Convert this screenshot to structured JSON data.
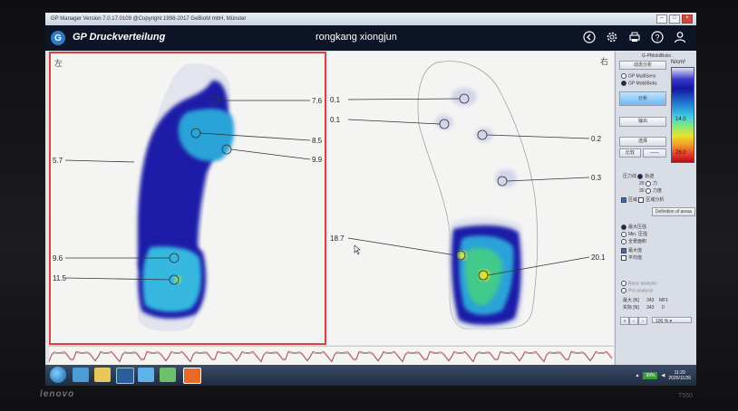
{
  "window": {
    "title": "GP Manager    Version 7.0.17.0109     @Copyright 1998-2017 GeBioM mbH, Münster"
  },
  "header": {
    "app_title": "GP Druckverteilung",
    "patient_name": "rongkang xiongjun"
  },
  "header_icons": [
    "back-icon",
    "gear-icon",
    "print-icon",
    "help-icon",
    "user-icon"
  ],
  "left_foot": {
    "side_label": "左",
    "values": [
      "7.6",
      "8.5",
      "9.9",
      "5.7",
      "9.6",
      "11.5"
    ]
  },
  "right_foot": {
    "side_label": "右",
    "values": [
      "0.1",
      "0.1",
      "0.2",
      "0.3",
      "18.7",
      "20.1"
    ]
  },
  "sidebar": {
    "title": "G-PMobilBoks",
    "top_button": "动态分析",
    "radio1": "GP MultiSens",
    "radio2": "GP MobilBoks",
    "btn_analysis": "分析",
    "btn2": "输出",
    "btn3": "选择",
    "small_btn1": "比较",
    "small_btn2": "——",
    "units": "N/cm²",
    "scale": [
      "14.0",
      "26.0"
    ],
    "opt1": "压力线",
    "opt2": "轨迹",
    "opt3": "20",
    "opt4": "力",
    "opt5": "30",
    "opt6": "力度",
    "chk1": "区域",
    "chk2": "区域分析",
    "definition_btn": "Definition of areas",
    "list": [
      "最大压强",
      "Min. 压强",
      "全景面积",
      "最大值",
      "平均值"
    ],
    "analysis_labels": [
      "Basic analysis",
      "Pro analysis"
    ],
    "table_headers": [
      "最大 [N]",
      "343",
      "MF1"
    ],
    "table_row": [
      "实际 [N]",
      "343",
      "0"
    ],
    "zoom_value": "100 %"
  },
  "taskbar": {
    "time": "11:20",
    "date": "2020/11/26",
    "battery": "99%"
  },
  "bezel": {
    "brand": "lenovo",
    "model": "T550"
  }
}
